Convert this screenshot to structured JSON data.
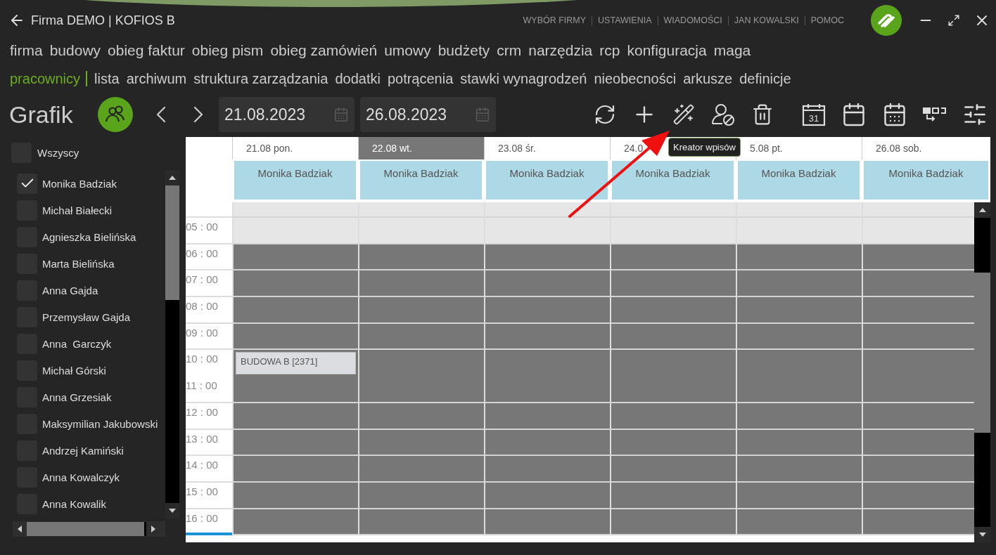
{
  "window": {
    "title": "Firma DEMO | KOFIOS B"
  },
  "top_links": [
    "WYBÓR FIRMY",
    "USTAWIENIA",
    "WIADOMOŚCI",
    "JAN KOWALSKI",
    "POMOC"
  ],
  "main_menu": [
    "firma",
    "budowy",
    "obieg faktur",
    "obieg pism",
    "obieg zamówień",
    "umowy",
    "budżety",
    "crm",
    "narzędzia",
    "rcp",
    "konfiguracja",
    "maga"
  ],
  "sub_menu": {
    "section": "pracownicy",
    "items": [
      "lista",
      "archiwum",
      "struktura zarządzania",
      "dodatki",
      "potrącenia",
      "stawki wynagrodzeń",
      "nieobecności",
      "arkusze",
      "definicje"
    ]
  },
  "toolbar": {
    "title": "Grafik",
    "date_from": "21.08.2023",
    "date_to": "26.08.2023",
    "calendar_day": "31",
    "tooltip": "Kreator wpisów"
  },
  "employees": {
    "all_label": "Wszyscy",
    "all_checked": false,
    "items": [
      {
        "name": "Monika Badziak",
        "checked": true
      },
      {
        "name": "Michał Białecki",
        "checked": false
      },
      {
        "name": "Agnieszka Bielińska",
        "checked": false
      },
      {
        "name": "Marta Bielińska",
        "checked": false
      },
      {
        "name": "Anna Gajda",
        "checked": false
      },
      {
        "name": "Przemysław Gajda",
        "checked": false
      },
      {
        "name": "Anna  Garczyk",
        "checked": false
      },
      {
        "name": "Michał Górski",
        "checked": false
      },
      {
        "name": "Anna Grzesiak",
        "checked": false
      },
      {
        "name": "Maksymilian Jakubowski",
        "checked": false
      },
      {
        "name": "Andrzej Kamiński",
        "checked": false
      },
      {
        "name": "Anna Kowalczyk",
        "checked": false
      },
      {
        "name": "Anna Kowalik",
        "checked": false
      }
    ]
  },
  "schedule": {
    "days": [
      {
        "label": "21.08 pon.",
        "selected": false,
        "employee": "Monika Badziak"
      },
      {
        "label": "22.08 wt.",
        "selected": true,
        "employee": "Monika Badziak"
      },
      {
        "label": "23.08 śr.",
        "selected": false,
        "employee": "Monika Badziak"
      },
      {
        "label": "24.0",
        "selected": false,
        "employee": "Monika Badziak"
      },
      {
        "label": "5.08 pt.",
        "selected": false,
        "employee": "Monika Badziak"
      },
      {
        "label": "26.08 sob.",
        "selected": false,
        "employee": "Monika Badziak"
      }
    ],
    "hours": [
      {
        "kind": "partial"
      },
      {
        "label": "05 : 00",
        "kind": "off"
      },
      {
        "label": "06 : 00",
        "kind": "work"
      },
      {
        "label": "07 : 00",
        "kind": "work"
      },
      {
        "label": "08 : 00",
        "kind": "work"
      },
      {
        "label": "09 : 00",
        "kind": "work"
      },
      {
        "label": "10 : 00",
        "kind": "work",
        "entries": [
          "BUDOWA B [2371]"
        ]
      },
      {
        "label": "11 : 00",
        "kind": "work"
      },
      {
        "label": "12 : 00",
        "kind": "work"
      },
      {
        "label": "13 : 00",
        "kind": "work"
      },
      {
        "label": "14 : 00",
        "kind": "work"
      },
      {
        "label": "15 : 00",
        "kind": "work"
      },
      {
        "label": "16 : 00",
        "kind": "work",
        "current": true
      }
    ]
  }
}
